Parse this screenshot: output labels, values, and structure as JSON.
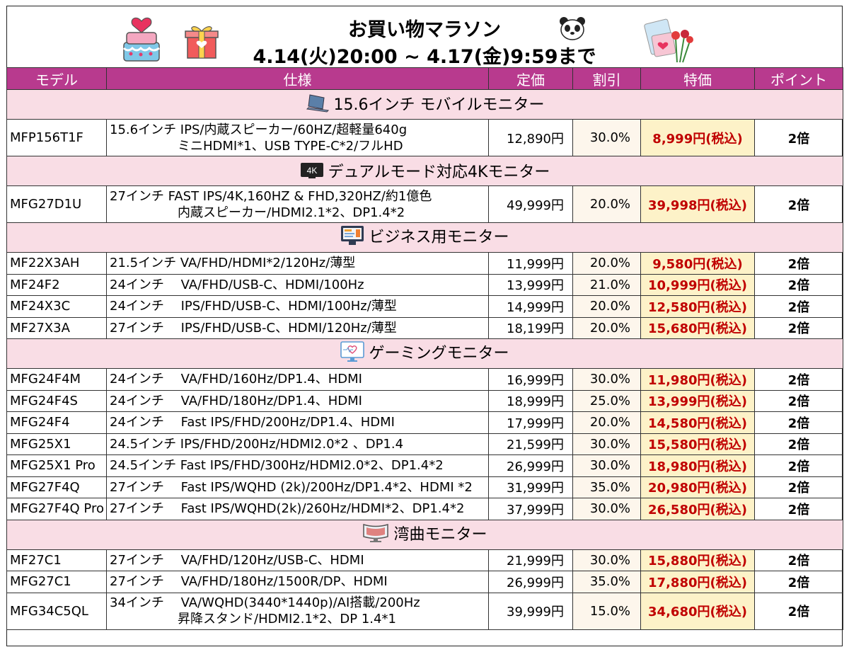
{
  "header": {
    "title": "お買い物マラソン",
    "period": "4.14(火)20:00 ~ 4.17(金)9:59まで"
  },
  "columns": [
    "モデル",
    "仕様",
    "定価",
    "割引",
    "特価",
    "ポイント"
  ],
  "sections": [
    {
      "title": "15.6インチ モバイルモニター",
      "icon": "laptop-icon",
      "rows": [
        {
          "model": "MFP156T1F",
          "spec": [
            "15.6インチ IPS/内蔵スピーカー/60HZ/超軽量640g",
            "ミニHDMI*1、USB TYPE-C*2/フルHD"
          ],
          "price": "12,890円",
          "discount": "30.0%",
          "sale": "8,999円(税込)",
          "points": "2倍"
        }
      ]
    },
    {
      "title": "デュアルモード対応4Kモニター",
      "icon": "4k-badge-icon",
      "icon_text": "4K",
      "rows": [
        {
          "model": "MFG27D1U",
          "spec": [
            "27インチ FAST IPS/4K,160HZ & FHD,320HZ/約1億色",
            "内蔵スピーカー/HDMI2.1*2、DP1.4*2"
          ],
          "price": "49,999円",
          "discount": "20.0%",
          "sale": "39,998円(税込)",
          "points": "2倍"
        }
      ]
    },
    {
      "title": "ビジネス用モニター",
      "icon": "business-monitor-icon",
      "rows": [
        {
          "model": "MF22X3AH",
          "spec": [
            "21.5インチ VA/FHD/HDMI*2/120Hz/薄型"
          ],
          "price": "11,999円",
          "discount": "20.0%",
          "sale": "9,580円(税込)",
          "points": "2倍"
        },
        {
          "model": "MF24F2",
          "spec": [
            "24インチ　 VA/FHD/USB-C、HDMI/100Hz"
          ],
          "price": "13,999円",
          "discount": "21.0%",
          "sale": "10,999円(税込)",
          "points": "2倍"
        },
        {
          "model": "MF24X3C",
          "spec": [
            "24インチ　 IPS/FHD/USB-C、HDMI/100Hz/薄型"
          ],
          "price": "14,999円",
          "discount": "20.0%",
          "sale": "12,580円(税込)",
          "points": "2倍"
        },
        {
          "model": "MF27X3A",
          "spec": [
            "27インチ　 IPS/FHD/USB-C、HDMI/120Hz/薄型"
          ],
          "price": "18,199円",
          "discount": "20.0%",
          "sale": "15,680円(税込)",
          "points": "2倍"
        }
      ]
    },
    {
      "title": "ゲーミングモニター",
      "icon": "gaming-monitor-icon",
      "rows": [
        {
          "model": "MFG24F4M",
          "spec": [
            "24インチ　 VA/FHD/160Hz/DP1.4、HDMI"
          ],
          "price": "16,999円",
          "discount": "30.0%",
          "sale": "11,980円(税込)",
          "points": "2倍"
        },
        {
          "model": "MFG24F4S",
          "spec": [
            "24インチ　 VA/FHD/180Hz/DP1.4、HDMI"
          ],
          "price": "18,999円",
          "discount": "25.0%",
          "sale": "13,999円(税込)",
          "points": "2倍"
        },
        {
          "model": "MFG24F4",
          "spec": [
            "24インチ　 Fast IPS/FHD/200Hz/DP1.4、HDMI"
          ],
          "price": "17,999円",
          "discount": "20.0%",
          "sale": "14,580円(税込)",
          "points": "2倍"
        },
        {
          "model": "MFG25X1",
          "spec": [
            "24.5インチ IPS/FHD/200Hz/HDMI2.0*2 、DP1.4"
          ],
          "price": "21,599円",
          "discount": "30.0%",
          "sale": "15,580円(税込)",
          "points": "2倍"
        },
        {
          "model": "MFG25X1 Pro",
          "spec": [
            "24.5インチ Fast IPS/FHD/300Hz/HDMI2.0*2、DP1.4*2"
          ],
          "price": "26,999円",
          "discount": "30.0%",
          "sale": "18,980円(税込)",
          "points": "2倍"
        },
        {
          "model": "MFG27F4Q",
          "spec": [
            "27インチ　 Fast IPS/WQHD (2k)/200Hz/DP1.4*2、HDMI *2"
          ],
          "price": "31,999円",
          "discount": "35.0%",
          "sale": "20,980円(税込)",
          "points": "2倍"
        },
        {
          "model": "MFG27F4Q Pro",
          "spec": [
            "27インチ　 Fast IPS/WQHD(2k)/260Hz/HDMI*2、DP1.4*2"
          ],
          "price": "37,999円",
          "discount": "30.0%",
          "sale": "26,580円(税込)",
          "points": "2倍"
        }
      ]
    },
    {
      "title": "湾曲モニター",
      "icon": "curved-monitor-icon",
      "rows": [
        {
          "model": "MF27C1",
          "spec": [
            "27インチ　 VA/FHD/120Hz/USB-C、HDMI"
          ],
          "price": "21,999円",
          "discount": "30.0%",
          "sale": "15,880円(税込)",
          "points": "2倍"
        },
        {
          "model": "MFG27C1",
          "spec": [
            "27インチ　 VA/FHD/180Hz/1500R/DP、HDMI"
          ],
          "price": "26,999円",
          "discount": "35.0%",
          "sale": "17,880円(税込)",
          "points": "2倍"
        },
        {
          "model": "MFG34C5QL",
          "spec": [
            "34インチ　 VA/WQHD(3440*1440p)/AI搭載/200Hz",
            "昇降スタンド/HDMI2.1*2、DP 1.4*1"
          ],
          "price": "39,999円",
          "discount": "15.0%",
          "sale": "34,680円(税込)",
          "points": "2倍"
        }
      ]
    }
  ],
  "decorations": [
    "cake-icon",
    "gift-box-icon",
    "panda-icon",
    "flowers-letter-icon"
  ],
  "colors": {
    "header_bg": "#b83a8e",
    "category_bg": "#f9dde5",
    "sale_bg": "#fdf2c8",
    "sale_text": "#c00000",
    "discount_bg": "#fdf6ec"
  }
}
